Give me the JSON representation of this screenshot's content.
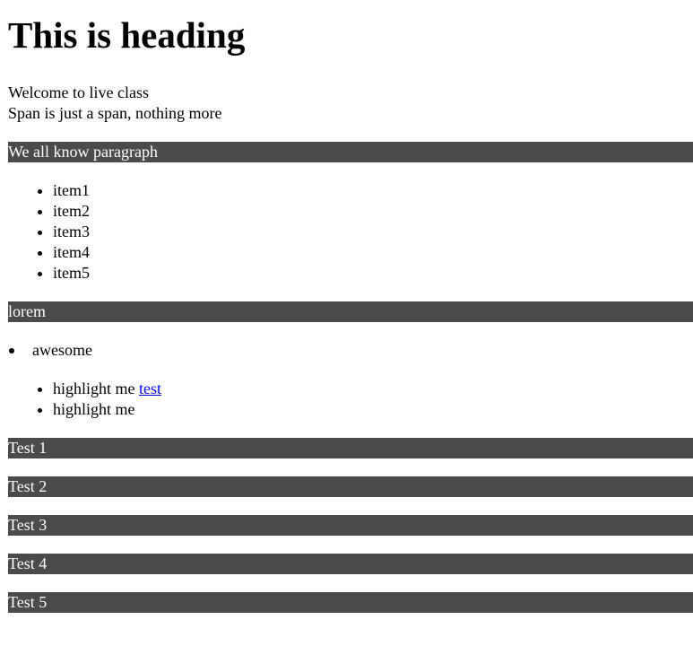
{
  "heading": "This is heading",
  "welcome": "Welcome to live class",
  "span_text": "Span is just a span, nothing more",
  "paragraph_bar": "We all know paragraph",
  "list1": [
    "item1",
    "item2",
    "item3",
    "item4",
    "item5"
  ],
  "lorem_bar": "lorem",
  "awesome_item": "awesome",
  "highlight_items": [
    {
      "text": "highlight me",
      "link": "test"
    },
    {
      "text": "highlight me"
    }
  ],
  "test_bars": [
    "Test 1",
    "Test 2",
    "Test 3",
    "Test 4",
    "Test 5"
  ],
  "colors": {
    "bar_background": "#4b4b4b",
    "bar_text": "#ffffff",
    "link": "#0000ee"
  }
}
